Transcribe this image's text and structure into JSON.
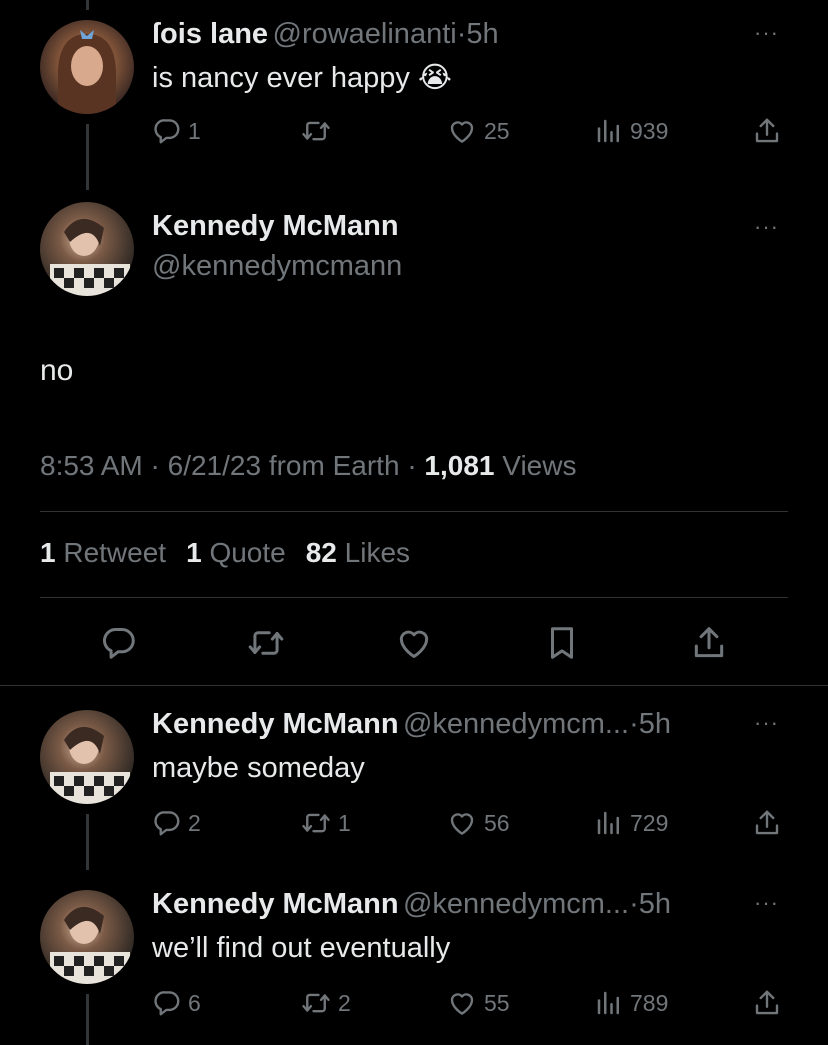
{
  "parent_tweet": {
    "name": "ſois lane",
    "handle": "@rowaelinanti",
    "sep": "·",
    "time": "5h",
    "text": "is nancy ever happy",
    "emoji": "😭",
    "replies": "1",
    "retweets": "",
    "likes": "25",
    "views": "939"
  },
  "main_tweet": {
    "name": "Kennedy McMann",
    "handle": "@kennedymcmann",
    "text": "no",
    "time": "8:53 AM",
    "date": "6/21/23",
    "source": "from Earth",
    "views_count": "1,081",
    "views_label": "Views",
    "retweets_count": "1",
    "retweets_label": "Retweet",
    "quotes_count": "1",
    "quotes_label": "Quote",
    "likes_count": "82",
    "likes_label": "Likes"
  },
  "replies": [
    {
      "name": "Kennedy McMann",
      "handle": "@kennedymcm...",
      "sep": "·",
      "time": "5h",
      "text": "maybe someday",
      "replies": "2",
      "retweets": "1",
      "likes": "56",
      "views": "729"
    },
    {
      "name": "Kennedy McMann",
      "handle": "@kennedymcm...",
      "sep": "·",
      "time": "5h",
      "text": "we’ll find out eventually",
      "replies": "6",
      "retweets": "2",
      "likes": "55",
      "views": "789"
    }
  ],
  "more_glyph": "···",
  "dot": "·",
  "colors": {
    "background": "#000000",
    "text_primary": "#e7e9ea",
    "text_secondary": "#71767b",
    "divider": "#2f3336"
  }
}
